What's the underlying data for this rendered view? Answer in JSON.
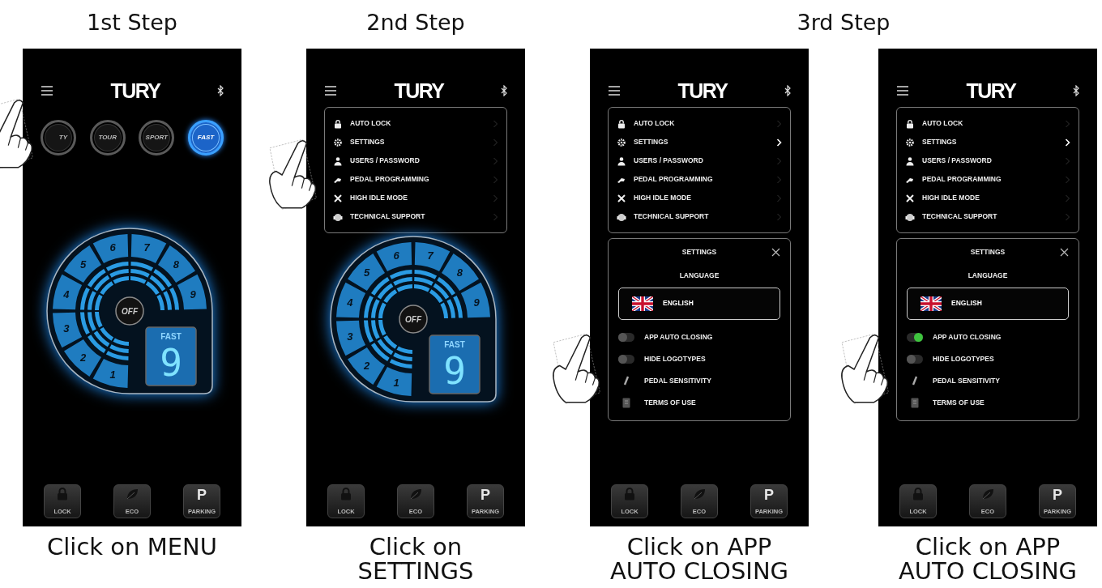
{
  "steps": [
    {
      "heading": "1st Step",
      "phones": [
        {
          "kind": "dashboard",
          "logo": "TURY",
          "modes": [
            {
              "label": "TY",
              "selected": false
            },
            {
              "label": "TOUR",
              "selected": false
            },
            {
              "label": "SPORT",
              "selected": false
            },
            {
              "label": "FAST",
              "selected": true
            }
          ],
          "dial": {
            "segments": [
              "1",
              "2",
              "3",
              "4",
              "5",
              "6",
              "7",
              "8",
              "9"
            ],
            "center": "OFF",
            "display_label": "FAST",
            "display_value": "9"
          },
          "dock": [
            {
              "label": "LOCK"
            },
            {
              "label": "ECO"
            },
            {
              "label": "PARKING",
              "glyph": "P"
            }
          ],
          "caption": "Click on MENU"
        }
      ]
    },
    {
      "heading": "2nd Step",
      "phones": [
        {
          "kind": "menu",
          "logo": "TURY",
          "menu": [
            {
              "label": "AUTO LOCK",
              "selected": false
            },
            {
              "label": "SETTINGS",
              "selected": false
            },
            {
              "label": "USERS / PASSWORD",
              "selected": false
            },
            {
              "label": "PEDAL PROGRAMMING",
              "selected": false
            },
            {
              "label": "HIGH IDLE MODE",
              "selected": false
            },
            {
              "label": "TECHNICAL SUPPORT",
              "selected": false
            }
          ],
          "dial": {
            "segments": [
              "1",
              "2",
              "3",
              "4",
              "5",
              "6",
              "7",
              "8",
              "9"
            ],
            "center": "OFF",
            "display_label": "FAST",
            "display_value": "9"
          },
          "dock": [
            {
              "label": "LOCK"
            },
            {
              "label": "ECO"
            },
            {
              "label": "PARKING",
              "glyph": "P"
            }
          ],
          "caption": "Click on SETTINGS"
        }
      ]
    },
    {
      "heading": "3rd Step",
      "phones": [
        {
          "kind": "settings",
          "logo": "TURY",
          "menu": [
            {
              "label": "AUTO LOCK",
              "selected": false
            },
            {
              "label": "SETTINGS",
              "selected": true
            },
            {
              "label": "USERS / PASSWORD",
              "selected": false
            },
            {
              "label": "PEDAL PROGRAMMING",
              "selected": false
            },
            {
              "label": "HIGH IDLE MODE",
              "selected": false
            },
            {
              "label": "TECHNICAL SUPPORT",
              "selected": false
            }
          ],
          "settings": {
            "title": "SETTINGS",
            "language_heading": "LANGUAGE",
            "language": "ENGLISH",
            "rows": [
              {
                "kind": "toggle",
                "label": "APP AUTO CLOSING",
                "on": false
              },
              {
                "kind": "toggle",
                "label": "HIDE LOGOTYPES",
                "on": false
              },
              {
                "kind": "link",
                "label": "PEDAL SENSITIVITY"
              },
              {
                "kind": "link",
                "label": "TERMS OF USE"
              }
            ]
          },
          "dock": [
            {
              "label": "LOCK"
            },
            {
              "label": "ECO"
            },
            {
              "label": "PARKING",
              "glyph": "P"
            }
          ],
          "caption": "Click on APP AUTO CLOSING"
        },
        {
          "kind": "settings",
          "logo": "TURY",
          "menu": [
            {
              "label": "AUTO LOCK",
              "selected": false
            },
            {
              "label": "SETTINGS",
              "selected": true
            },
            {
              "label": "USERS / PASSWORD",
              "selected": false
            },
            {
              "label": "PEDAL PROGRAMMING",
              "selected": false
            },
            {
              "label": "HIGH IDLE MODE",
              "selected": false
            },
            {
              "label": "TECHNICAL SUPPORT",
              "selected": false
            }
          ],
          "settings": {
            "title": "SETTINGS",
            "language_heading": "LANGUAGE",
            "language": "ENGLISH",
            "rows": [
              {
                "kind": "toggle",
                "label": "APP AUTO CLOSING",
                "on": true
              },
              {
                "kind": "toggle",
                "label": "HIDE LOGOTYPES",
                "on": false
              },
              {
                "kind": "link",
                "label": "PEDAL SENSITIVITY"
              },
              {
                "kind": "link",
                "label": "TERMS OF USE"
              }
            ]
          },
          "dock": [
            {
              "label": "LOCK"
            },
            {
              "label": "ECO"
            },
            {
              "label": "PARKING",
              "glyph": "P"
            }
          ],
          "caption": "Click on APP AUTO CLOSING"
        }
      ]
    }
  ]
}
